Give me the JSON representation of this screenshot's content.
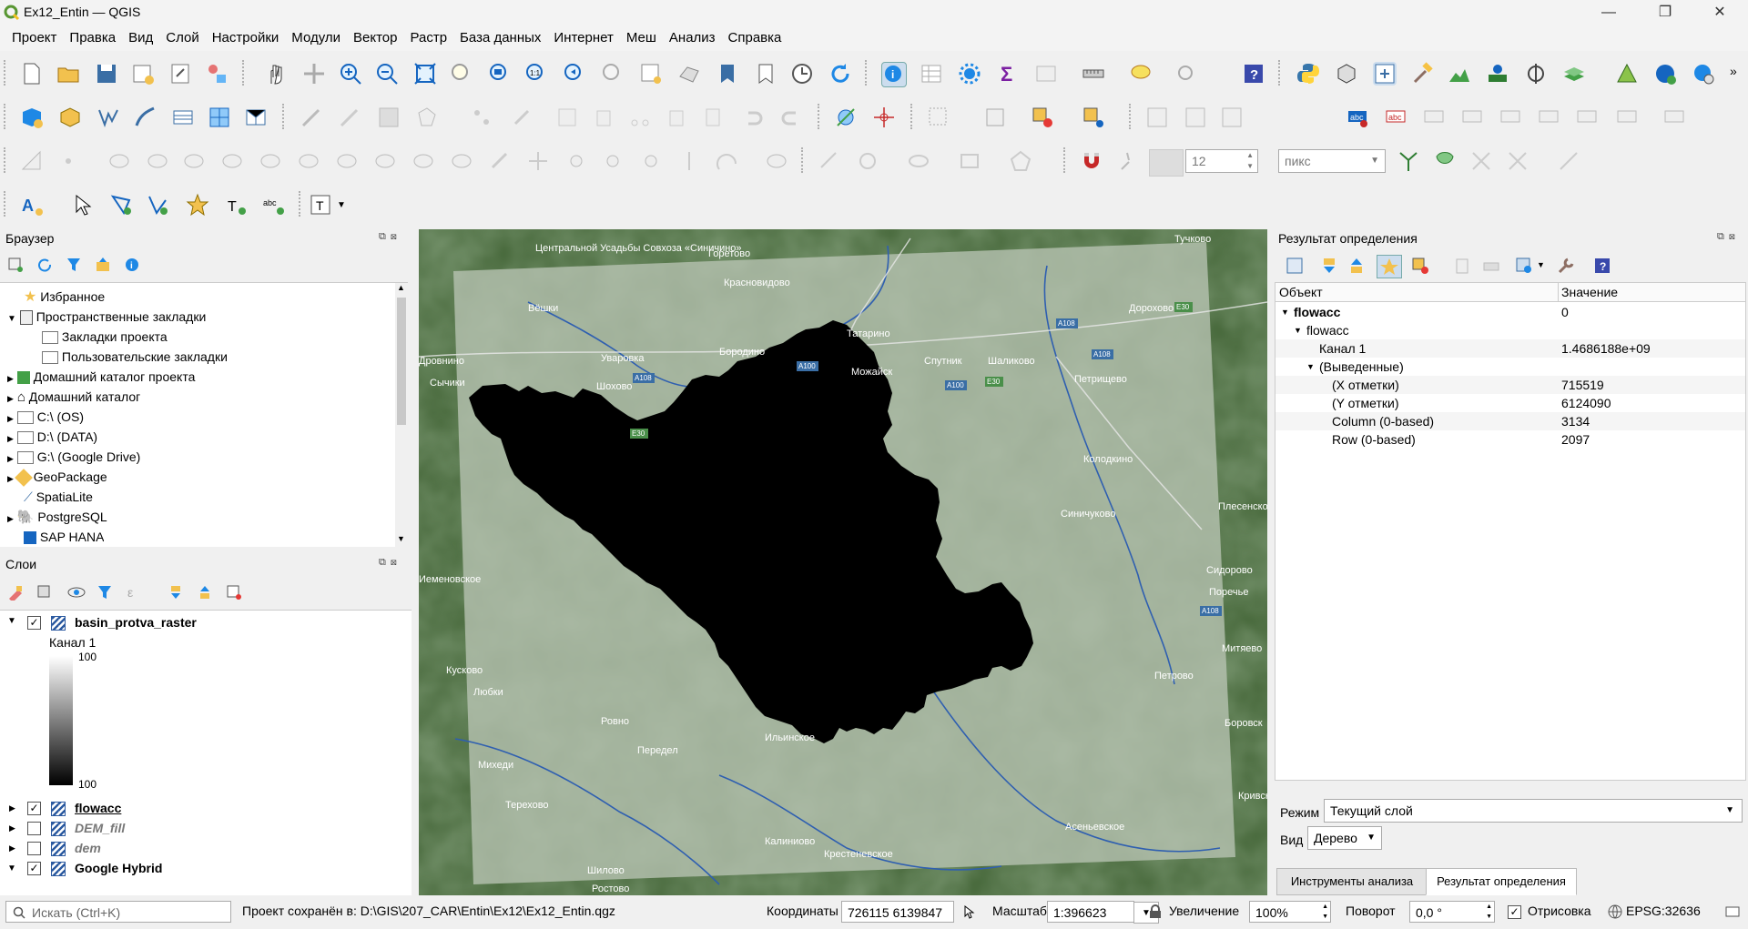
{
  "window": {
    "title": "Ex12_Entin — QGIS",
    "controls": [
      "—",
      "❐",
      "✕"
    ]
  },
  "menu": [
    "Проект",
    "Правка",
    "Вид",
    "Слой",
    "Настройки",
    "Модули",
    "Вектор",
    "Растр",
    "База данных",
    "Интернет",
    "Меш",
    "Анализ",
    "Справка"
  ],
  "snapping": {
    "tolerance": "12",
    "units": "пикс"
  },
  "browser": {
    "title": "Браузер",
    "items": [
      {
        "label": "Избранное"
      },
      {
        "label": "Пространственные закладки"
      },
      {
        "label": "Закладки проекта"
      },
      {
        "label": "Пользовательские закладки"
      },
      {
        "label": "Домашний каталог проекта"
      },
      {
        "label": "Домашний каталог"
      },
      {
        "label": "C:\\ (OS)"
      },
      {
        "label": "D:\\ (DATA)"
      },
      {
        "label": "G:\\ (Google Drive)"
      },
      {
        "label": "GeoPackage"
      },
      {
        "label": "SpatiaLite"
      },
      {
        "label": "PostgreSQL"
      },
      {
        "label": "SAP HANA"
      }
    ]
  },
  "layers": {
    "title": "Слои",
    "items": [
      {
        "name": "basin_protva_raster",
        "checked": true,
        "style": "bold"
      },
      {
        "name": "flowacc",
        "checked": true,
        "style": "bold-underline"
      },
      {
        "name": "DEM_fill",
        "checked": false,
        "style": "bold-italic-grey"
      },
      {
        "name": "dem",
        "checked": false,
        "style": "bold-italic-grey"
      },
      {
        "name": "Google Hybrid",
        "checked": true,
        "style": "bold"
      }
    ],
    "legend": {
      "band": "Канал 1",
      "max": "100",
      "min": "100"
    }
  },
  "identify": {
    "title": "Результат определения",
    "col_object": "Объект",
    "col_value": "Значение",
    "rows": [
      {
        "label": "flowacc",
        "value": "0"
      },
      {
        "label": "flowacc",
        "value": ""
      },
      {
        "label": "Канал 1",
        "value": "1.4686188e+09"
      },
      {
        "label": "(Выведенные)",
        "value": ""
      },
      {
        "label": "(X отметки)",
        "value": "715519"
      },
      {
        "label": "(Y отметки)",
        "value": "6124090"
      },
      {
        "label": "Column (0-based)",
        "value": "3134"
      },
      {
        "label": "Row (0-based)",
        "value": "2097"
      }
    ],
    "mode_label": "Режим",
    "mode_value": "Текущий слой",
    "view_label": "Вид",
    "view_value": "Дерево",
    "tabs": [
      "Инструменты анализа",
      "Результат определения"
    ]
  },
  "map": {
    "places": [
      "Центральной Усадьбы Совхоза «Синичино»",
      "Горетово",
      "Тучково",
      "Красновидово",
      "Дорохово",
      "Вёшки",
      "Татарино",
      "Уваровка",
      "Бородино",
      "Можайск",
      "Спутник",
      "Шаликово",
      "Петрищево",
      "Шохово",
      "Сычики",
      "Дровнино",
      "Колодкино",
      "Плесенское",
      "Сидорово",
      "Синичуково",
      "Поречье",
      "Иеменовское",
      "Митяево",
      "Кусково",
      "Петрово",
      "Любки",
      "Боровск",
      "Ровно",
      "Ильинское",
      "Передел",
      "Михеди",
      "Кривское",
      "Терехово",
      "Асеньевское",
      "Калиниово",
      "Крестеневское",
      "Шилово",
      "Ростово"
    ],
    "roads": [
      "A108",
      "E30",
      "A100",
      "E30",
      "A108",
      "A100",
      "A108",
      "E30",
      "A108"
    ]
  },
  "status": {
    "search_placeholder": "Искать (Ctrl+K)",
    "saved": "Проект сохранён в: D:\\GIS\\207_CAR\\Entin\\Ex12\\Ex12_Entin.qgz",
    "coord_label": "Координаты",
    "coord_value": "726115  6139847",
    "scale_label": "Масштаб",
    "scale_value": "1:396623",
    "zoom_label": "Увеличение",
    "zoom_value": "100%",
    "rotation_label": "Поворот",
    "rotation_value": "0,0 °",
    "render_label": "Отрисовка",
    "crs": "EPSG:32636"
  },
  "colors": {
    "accent": "#589632",
    "map_forest": "#3a5a32",
    "mask": "#000000"
  }
}
